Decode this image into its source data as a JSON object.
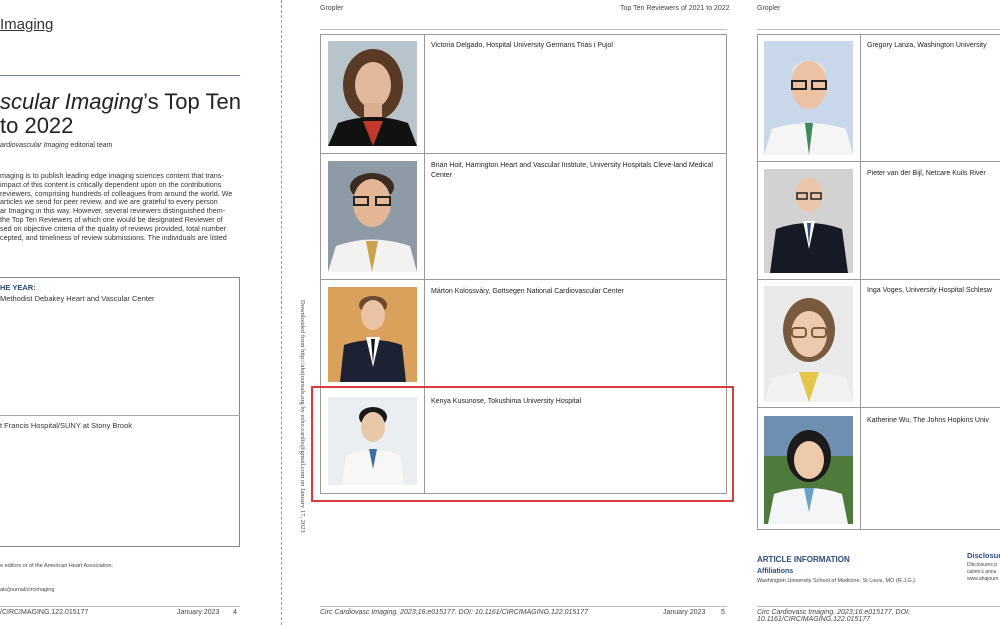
{
  "left_page": {
    "journal_header": "Imaging",
    "title_line1_italic": "scular Imaging",
    "title_line1_rest": "’s Top Ten",
    "title_line2": "to 2022",
    "subtitle_italic": "ardiovascular Imaging",
    "subtitle_rest": " editorial team",
    "body_lines": [
      "maging is to publish leading edge imaging sciences content that trans-",
      "impact of this content is critically dependent upon on the contributions",
      "reviewers, comprising hundreds of colleagues from around the world. We",
      "articles we send for peer review, and we are grateful to every person",
      "ar Imaging in this way. However, several reviewers distinguished them-",
      "the Top Ten Reviewers of which one would be designated Reviewer of",
      "sed on objective criteria of the quality of reviews provided, total number",
      "cepted, and timeliness of review submissions. The individuals are listed"
    ],
    "reviewer_of_year_label": "HE YEAR:",
    "reviewer_of_year_aff": "Methodist Debakey Heart and Vascular Center",
    "second_aff": "t Francis Hospital/SUNY at Stony Brook",
    "footnote": "e editors or of the American Heart Association.",
    "url": "als/journal/circimaging",
    "doi": "/CIRCIMAGING.122.015177",
    "date": "January 2023",
    "page": "4"
  },
  "gutter_note": "Downloaded from http://ahajournals.org by echo.cardio@gmail.com on January 17, 2023",
  "middle_page": {
    "header_left": "Gropler",
    "header_right": "Top Ten Reviewers of 2021 to 2022",
    "reviewers": [
      {
        "name": "Victoria Delgado, Hospital University Germans Trias i Pujol"
      },
      {
        "name": "Brian Hoit, Harrington Heart and Vascular Institute, University Hospitals Cleve-land Medical Center"
      },
      {
        "name": "Márton Kolossváry, Gottsegen National Cardiovascular Center"
      },
      {
        "name": "Kenya Kusunose, Tokushima University Hospital"
      }
    ],
    "doi": "Circ Cardiovasc Imaging. 2023;16:e015177. DOI: 10.1161/CIRCIMAGING.122.015177",
    "date": "January 2023",
    "page": "5"
  },
  "right_page": {
    "header_left": "Gropler",
    "reviewers": [
      {
        "name": "Gregory Lanza, Washington University"
      },
      {
        "name": "Pieter van der Bijl, Netcare Kuils River"
      },
      {
        "name": "Inga Voges, University Hospital Schlesw"
      },
      {
        "name": "Katherine Wu, The Johns Hopkins Univ"
      }
    ],
    "article_info_title": "ARTICLE INFORMATION",
    "affiliations_label": "Affiliations",
    "affiliation_text": "Washington University School of Medicine, St Louis, MO (R.J.G.).",
    "disclosures_title": "Disclosure",
    "disclosures_lines": [
      "Disclosures p",
      "cation’s annu",
      "www.ahajourn"
    ],
    "doi": "Circ Cardiovasc Imaging. 2023;16:e015177. DOI: 10.1161/CIRCIMAGING.122.015177"
  },
  "colors": {
    "highlight": "#d93a3a",
    "heading_blue": "#2a4a7a"
  }
}
